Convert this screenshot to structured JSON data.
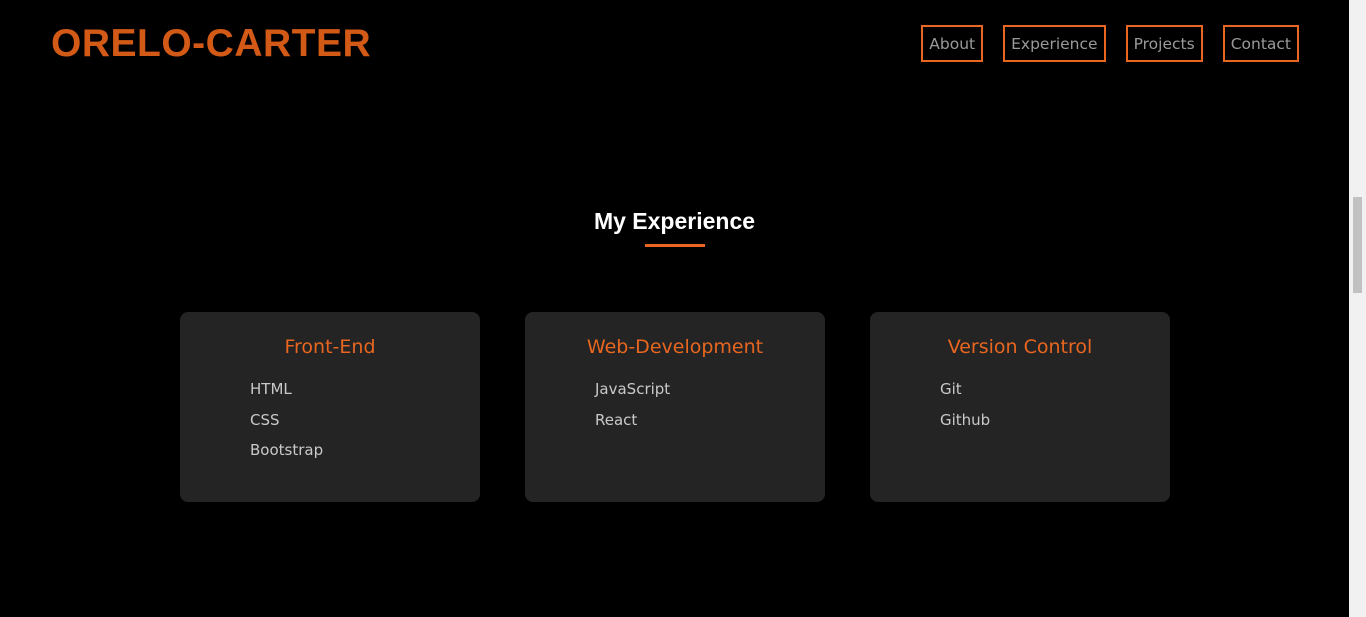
{
  "header": {
    "logo": "ORELO-CARTER",
    "nav": [
      {
        "label": "About"
      },
      {
        "label": "Experience"
      },
      {
        "label": "Projects"
      },
      {
        "label": "Contact"
      }
    ]
  },
  "experience": {
    "title": "My Experience",
    "cards": [
      {
        "title": "Front-End",
        "skills": [
          "HTML",
          "CSS",
          "Bootstrap"
        ]
      },
      {
        "title": "Web-Development",
        "skills": [
          "JavaScript",
          "React"
        ]
      },
      {
        "title": "Version Control",
        "skills": [
          "Git",
          "Github"
        ]
      }
    ]
  },
  "colors": {
    "accent": "#e8661f",
    "logo": "#d35a16",
    "background": "#000000",
    "card_bg": "#242424"
  }
}
